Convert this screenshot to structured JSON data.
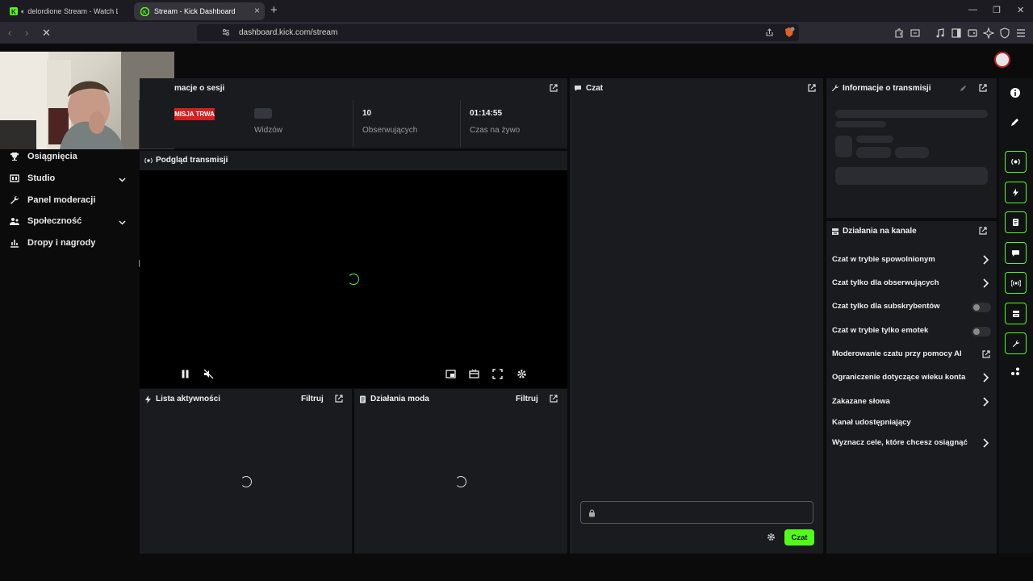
{
  "browser": {
    "tabs": [
      {
        "title": "delordione Stream - Watch Live o",
        "active": false
      },
      {
        "title": "Stream - Kick Dashboard",
        "active": true
      }
    ],
    "url": "dashboard.kick.com/stream"
  },
  "sidebar": {
    "items": [
      {
        "label": "Osiągnięcia",
        "icon": "trophy-icon",
        "expandable": false
      },
      {
        "label": "Studio",
        "icon": "studio-icon",
        "expandable": true
      },
      {
        "label": "Panel moderacji",
        "icon": "wrench-icon",
        "expandable": false
      },
      {
        "label": "Społeczność",
        "icon": "community-icon",
        "expandable": true
      },
      {
        "label": "Dropy i nagrody",
        "icon": "drops-icon",
        "expandable": false
      }
    ]
  },
  "session": {
    "title": "macje o sesji",
    "live_badge": "MISJA TRWA",
    "stats": [
      {
        "value": "",
        "label": "Widzów"
      },
      {
        "value": "10",
        "label": "Obserwujących"
      },
      {
        "value": "01:14:55",
        "label": "Czas na żywo"
      }
    ]
  },
  "preview": {
    "title": "Podgląd transmisji"
  },
  "activity": {
    "title": "Lista aktywności",
    "filter": "Filtruj"
  },
  "modactions": {
    "title": "Działania moda",
    "filter": "Filtruj"
  },
  "chat": {
    "title": "Czat",
    "send_label": "Czat",
    "input_placeholder": ""
  },
  "stream_info": {
    "title": "Informacje o transmisji"
  },
  "channel_actions": {
    "title": "Działania na kanale",
    "items": [
      {
        "label": "Czat w trybie spowolnionym",
        "control": "chevron"
      },
      {
        "label": "Czat tylko dla obserwujących",
        "control": "chevron"
      },
      {
        "label": "Czat tylko dla subskrybentów",
        "control": "toggle",
        "on": false
      },
      {
        "label": "Czat w trybie tylko emotek",
        "control": "toggle",
        "on": false
      },
      {
        "label": "Moderowanie czatu przy pomocy AI",
        "control": "external"
      },
      {
        "label": "Ograniczenie dotyczące wieku konta",
        "control": "chevron"
      },
      {
        "label": "Zakazane słowa",
        "control": "chevron"
      },
      {
        "label": "Kanał udostępniający",
        "control": "none"
      },
      {
        "label": "Wyznacz cele, które chcesz osiągnąć",
        "control": "chevron"
      }
    ]
  },
  "colors": {
    "accent": "#53fc18",
    "live": "#d61f1f",
    "panel": "#191b1f"
  }
}
